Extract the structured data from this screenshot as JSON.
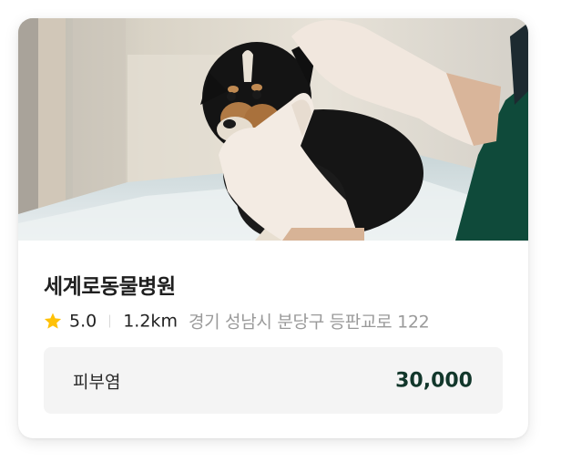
{
  "hospital": {
    "name": "세계로동물병원",
    "rating": "5.0",
    "distance": "1.2km",
    "address": "경기 성남시 분당구 등판교로 122",
    "photo_icon": "puppy-exam-photo"
  },
  "service": {
    "name": "피부염",
    "price": "30,000"
  },
  "colors": {
    "star": "#FFC107",
    "price": "#12372B",
    "price_box_bg": "#F4F4F4",
    "address": "#9A9A9A"
  }
}
